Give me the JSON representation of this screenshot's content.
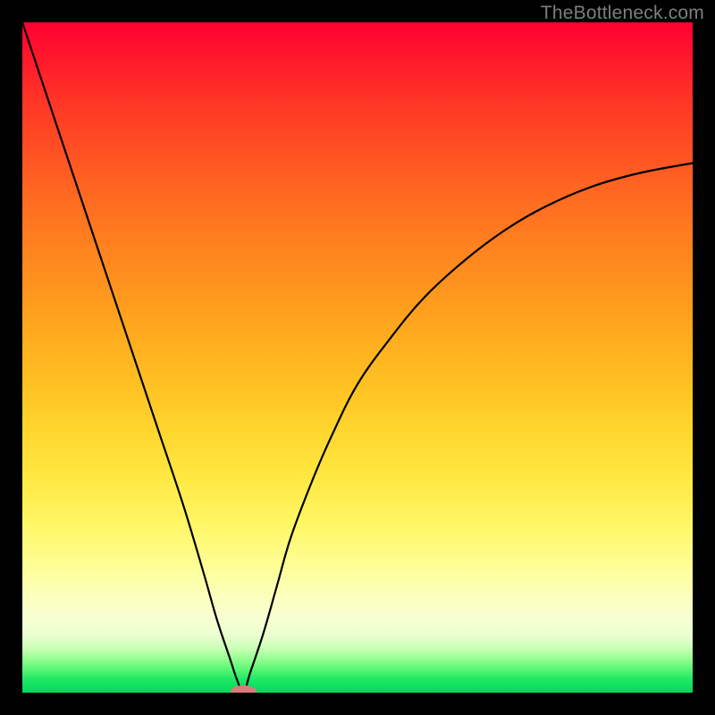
{
  "watermark": "TheBottleneck.com",
  "chart_data": {
    "type": "line",
    "title": "",
    "xlabel": "",
    "ylabel": "",
    "xlim": [
      0,
      100
    ],
    "ylim": [
      0,
      100
    ],
    "grid": false,
    "legend": false,
    "notes": "Bottleneck curve. X = component balance (relative), Y = bottleneck %. Minimum near x≈33 (marker). No axis ticks shown.",
    "marker": {
      "x": 33,
      "y": 0,
      "color": "#d77b7b",
      "rx": 2.0,
      "ry": 1.1
    },
    "series": [
      {
        "name": "bottleneck-curve",
        "color": "#000000",
        "x": [
          0,
          4,
          8,
          12,
          16,
          20,
          24,
          27,
          29,
          31,
          32,
          33,
          34,
          36,
          38,
          40,
          43,
          46,
          50,
          55,
          60,
          66,
          72,
          78,
          85,
          92,
          100
        ],
        "values": [
          100,
          88,
          76,
          64,
          52,
          40,
          28,
          18,
          11,
          5,
          2,
          0,
          3,
          9,
          16,
          23,
          31,
          38,
          46,
          53,
          59,
          64.5,
          69,
          72.5,
          75.5,
          77.5,
          79
        ]
      }
    ],
    "background_gradient": {
      "direction": "vertical",
      "stops": [
        {
          "pos": 0.0,
          "color": "#ff0030"
        },
        {
          "pos": 0.5,
          "color": "#ffb921"
        },
        {
          "pos": 0.8,
          "color": "#fdff8e"
        },
        {
          "pos": 0.93,
          "color": "#c6ffb2"
        },
        {
          "pos": 1.0,
          "color": "#00d85c"
        }
      ]
    }
  }
}
